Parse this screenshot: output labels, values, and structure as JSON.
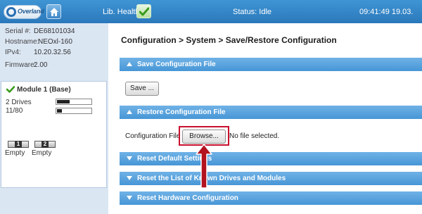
{
  "topbar": {
    "logo_text": "Overland",
    "lib_health_label": "Lib. Health:",
    "status_text": "Status: Idle",
    "clock_text": "09:41:49 19.03."
  },
  "sidebar": {
    "info": [
      {
        "label": "Serial #:",
        "value": "DE68101034"
      },
      {
        "label": "Hostname:",
        "value": "NEOxl-160"
      },
      {
        "label": "IPv4:",
        "value": "10.20.32.56"
      },
      {
        "label": "Firmware:",
        "value": "2.00"
      }
    ],
    "module": {
      "title": "Module 1 (Base)",
      "drives_label": "2 Drives",
      "drives_fill": 0.38,
      "slots_label": "11/80",
      "slots_fill": 0.14,
      "magazines": [
        {
          "number": "1",
          "label": "Empty"
        },
        {
          "number": "2",
          "label": "Empty"
        }
      ]
    }
  },
  "main": {
    "breadcrumb": "Configuration > System > Save/Restore Configuration",
    "sections": {
      "save": "Save Configuration File",
      "restore": "Restore Configuration File",
      "reset_defaults": "Reset Default Settings",
      "reset_list": "Reset the List of Known Drives and Modules",
      "reset_hardware": "Reset Hardware Configuration"
    },
    "save_button": "Save ...",
    "config_file_label": "Configuration File",
    "browse_button": "Browse...",
    "no_file_text": "No file selected."
  },
  "colors": {
    "topbar": "#2f82c5",
    "section_header": "#5aa3df",
    "sidebar_bg": "#dbe6f3",
    "highlight": "#c8102e",
    "health_ok": "#3a9a1e"
  }
}
